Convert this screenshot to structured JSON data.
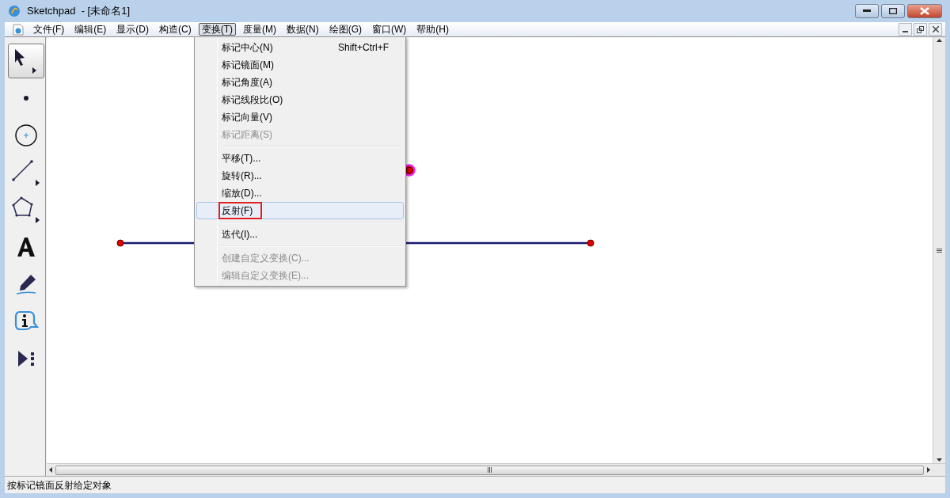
{
  "window": {
    "title": "Sketchpad  - [未命名1]"
  },
  "menu_bar": [
    {
      "label": "文件(F)",
      "selected": false
    },
    {
      "label": "编辑(E)",
      "selected": false
    },
    {
      "label": "显示(D)",
      "selected": false
    },
    {
      "label": "构造(C)",
      "selected": false
    },
    {
      "label": "变换(T)",
      "selected": true
    },
    {
      "label": "度量(M)",
      "selected": false
    },
    {
      "label": "数据(N)",
      "selected": false
    },
    {
      "label": "绘图(G)",
      "selected": false
    },
    {
      "label": "窗口(W)",
      "selected": false
    },
    {
      "label": "帮助(H)",
      "selected": false
    }
  ],
  "transform_menu": [
    {
      "kind": "item",
      "label": "标记中心(N)",
      "shortcut": "Shift+Ctrl+F",
      "disabled": false,
      "selected": false
    },
    {
      "kind": "item",
      "label": "标记镜面(M)",
      "disabled": false,
      "selected": false
    },
    {
      "kind": "item",
      "label": "标记角度(A)",
      "disabled": false,
      "selected": false
    },
    {
      "kind": "item",
      "label": "标记线段比(O)",
      "disabled": false,
      "selected": false
    },
    {
      "kind": "item",
      "label": "标记向量(V)",
      "disabled": false,
      "selected": false
    },
    {
      "kind": "item",
      "label": "标记距离(S)",
      "disabled": true,
      "selected": false
    },
    {
      "kind": "separator"
    },
    {
      "kind": "item",
      "label": "平移(T)...",
      "disabled": false,
      "selected": false
    },
    {
      "kind": "item",
      "label": "旋转(R)...",
      "disabled": false,
      "selected": false
    },
    {
      "kind": "item",
      "label": "缩放(D)...",
      "disabled": false,
      "selected": false
    },
    {
      "kind": "item",
      "label": "反射(F)",
      "disabled": false,
      "selected": true
    },
    {
      "kind": "separator"
    },
    {
      "kind": "item",
      "label": "迭代(I)...",
      "disabled": false,
      "selected": false
    },
    {
      "kind": "separator"
    },
    {
      "kind": "item",
      "label": "创建自定义变换(C)...",
      "disabled": true,
      "selected": false
    },
    {
      "kind": "item",
      "label": "编辑自定义变换(E)...",
      "disabled": true,
      "selected": false
    }
  ],
  "toolbox": [
    {
      "kind": "arrow",
      "selected": true
    },
    {
      "kind": "point",
      "selected": false
    },
    {
      "kind": "compass",
      "selected": false
    },
    {
      "kind": "straightedge",
      "selected": false
    },
    {
      "kind": "polygon",
      "selected": false
    },
    {
      "kind": "text",
      "selected": false
    },
    {
      "kind": "marker",
      "selected": false
    },
    {
      "kind": "info",
      "selected": false
    },
    {
      "kind": "custom",
      "selected": false
    }
  ],
  "status_bar": "按标记镜面反射给定对象"
}
